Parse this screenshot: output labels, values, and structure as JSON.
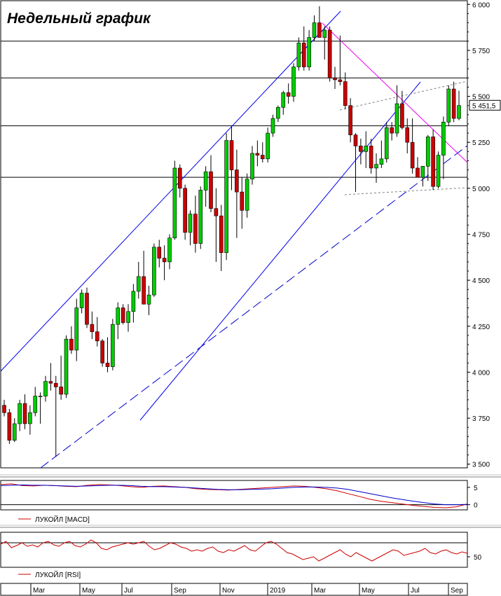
{
  "title": "Недельный график",
  "chart_data": [
    {
      "type": "candlestick",
      "name": "price",
      "title": "Недельный график",
      "ylim": [
        3480,
        6020
      ],
      "yticks": [
        3500,
        3750,
        4000,
        4250,
        4500,
        4750,
        5000,
        5250,
        5500,
        5750,
        6000
      ],
      "ytick_labels": [
        "3 500",
        "3 750",
        "4 000",
        "4 250",
        "4 500",
        "4 750",
        "5 000",
        "5 250",
        "5 500",
        "5 750",
        "6 000"
      ],
      "last_price_label": "5 451,5",
      "last_price": 5451.5,
      "horizontal_levels": [
        5800,
        5600,
        5340,
        5060
      ],
      "x_labels": [
        "Mar",
        "May",
        "Jul",
        "Sep",
        "Nov",
        "2019",
        "Mar",
        "May",
        "Jul",
        "Sep"
      ],
      "colors": {
        "up": "#00cc00",
        "down": "#cc0000",
        "channel": "#0000ee",
        "downtrend": "#ee00ee",
        "level": "#000000",
        "dotted": "#808080"
      },
      "candles_ohlc": [
        [
          3820,
          3850,
          3760,
          3780
        ],
        [
          3780,
          3800,
          3610,
          3630
        ],
        [
          3630,
          3750,
          3620,
          3720
        ],
        [
          3720,
          3850,
          3680,
          3830
        ],
        [
          3830,
          3880,
          3690,
          3720
        ],
        [
          3720,
          3820,
          3660,
          3780
        ],
        [
          3780,
          3920,
          3760,
          3870
        ],
        [
          3870,
          3890,
          3720,
          3870
        ],
        [
          3870,
          3980,
          3840,
          3950
        ],
        [
          3950,
          4050,
          3900,
          3940
        ],
        [
          3940,
          3980,
          3540,
          3920
        ],
        [
          3920,
          4090,
          3850,
          3880
        ],
        [
          3880,
          4200,
          3860,
          4180
        ],
        [
          4180,
          4250,
          4100,
          4120
        ],
        [
          4120,
          4400,
          4060,
          4350
        ],
        [
          4350,
          4450,
          4320,
          4430
        ],
        [
          4430,
          4460,
          4240,
          4260
        ],
        [
          4260,
          4330,
          4180,
          4220
        ],
        [
          4220,
          4300,
          4140,
          4170
        ],
        [
          4170,
          4180,
          4030,
          4050
        ],
        [
          4050,
          4190,
          4000,
          4030
        ],
        [
          4030,
          4290,
          4010,
          4260
        ],
        [
          4260,
          4380,
          4180,
          4350
        ],
        [
          4350,
          4370,
          4260,
          4270
        ],
        [
          4270,
          4370,
          4220,
          4330
        ],
        [
          4330,
          4480,
          4270,
          4440
        ],
        [
          4440,
          4600,
          4400,
          4520
        ],
        [
          4520,
          4660,
          4450,
          4370
        ],
        [
          4370,
          4470,
          4310,
          4420
        ],
        [
          4420,
          4700,
          4410,
          4680
        ],
        [
          4680,
          4720,
          4570,
          4620
        ],
        [
          4620,
          4690,
          4500,
          4600
        ],
        [
          4600,
          4750,
          4560,
          4730
        ],
        [
          4730,
          5150,
          4720,
          5110
        ],
        [
          5110,
          5130,
          4950,
          5000
        ],
        [
          5000,
          5020,
          4720,
          4760
        ],
        [
          4760,
          4880,
          4690,
          4860
        ],
        [
          4860,
          4960,
          4650,
          4700
        ],
        [
          4700,
          5010,
          4670,
          4990
        ],
        [
          4990,
          5120,
          4900,
          5090
        ],
        [
          5090,
          5180,
          4870,
          4890
        ],
        [
          4890,
          5000,
          4600,
          4850
        ],
        [
          4850,
          4910,
          4550,
          4650
        ],
        [
          4650,
          5300,
          4610,
          5260
        ],
        [
          5260,
          5340,
          4990,
          5100
        ],
        [
          5100,
          5210,
          4730,
          4980
        ],
        [
          4980,
          5060,
          4780,
          4880
        ],
        [
          4880,
          5080,
          4840,
          5050
        ],
        [
          5050,
          5230,
          5020,
          5190
        ],
        [
          5190,
          5260,
          5120,
          5180
        ],
        [
          5180,
          5250,
          5140,
          5160
        ],
        [
          5160,
          5330,
          5140,
          5300
        ],
        [
          5300,
          5400,
          5280,
          5380
        ],
        [
          5380,
          5450,
          5360,
          5440
        ],
        [
          5440,
          5530,
          5400,
          5520
        ],
        [
          5520,
          5570,
          5460,
          5500
        ],
        [
          5500,
          5680,
          5470,
          5660
        ],
        [
          5660,
          5820,
          5640,
          5790
        ],
        [
          5790,
          5880,
          5640,
          5660
        ],
        [
          5660,
          5860,
          5640,
          5820
        ],
        [
          5820,
          5940,
          5800,
          5900
        ],
        [
          5900,
          5990,
          5880,
          5820
        ],
        [
          5820,
          5880,
          5700,
          5860
        ],
        [
          5860,
          5880,
          5580,
          5600
        ],
        [
          5600,
          5660,
          5540,
          5590
        ],
        [
          5590,
          5830,
          5560,
          5580
        ],
        [
          5580,
          5630,
          5430,
          5450
        ],
        [
          5450,
          5490,
          5250,
          5290
        ],
        [
          5290,
          5300,
          4980,
          5230
        ],
        [
          5230,
          5270,
          5130,
          5200
        ],
        [
          5200,
          5310,
          5110,
          5230
        ],
        [
          5230,
          5270,
          5080,
          5110
        ],
        [
          5110,
          5190,
          5030,
          5130
        ],
        [
          5130,
          5260,
          5110,
          5160
        ],
        [
          5160,
          5360,
          5140,
          5330
        ],
        [
          5330,
          5360,
          5260,
          5300
        ],
        [
          5300,
          5560,
          5280,
          5460
        ],
        [
          5460,
          5530,
          5320,
          5330
        ],
        [
          5330,
          5380,
          5190,
          5250
        ],
        [
          5250,
          5380,
          5080,
          5110
        ],
        [
          5110,
          5170,
          5060,
          5060
        ],
        [
          5060,
          5110,
          5010,
          5120
        ],
        [
          5120,
          5290,
          5040,
          5280
        ],
        [
          5280,
          5320,
          4990,
          5010
        ],
        [
          5010,
          5200,
          5000,
          5180
        ],
        [
          5180,
          5390,
          5050,
          5360
        ],
        [
          5360,
          5560,
          5340,
          5540
        ],
        [
          5540,
          5580,
          5360,
          5380
        ],
        [
          5380,
          5530,
          5370,
          5450
        ]
      ]
    },
    {
      "type": "line",
      "name": "macd-panel",
      "ylim": [
        -1.5,
        7
      ],
      "yticks": [
        0,
        5
      ],
      "ytick_labels": [
        "0",
        "5"
      ],
      "legend": "ЛУКОЙЛ [MACD]",
      "series": [
        {
          "color": "#cc0000",
          "values": [
            5.8,
            6.0,
            5.5,
            5.4,
            5.6,
            5.5,
            5.3,
            5.2,
            5.6,
            5.8,
            5.7,
            5.5,
            5.2,
            5.0,
            5.3,
            5.4,
            5.2,
            5.0,
            4.6,
            4.4,
            4.3,
            4.2,
            4.4,
            4.6,
            4.8,
            5.0,
            5.2,
            5.4,
            5.3,
            5.0,
            4.6,
            4.0,
            3.2,
            2.4,
            1.6,
            1.0,
            0.6,
            0.2,
            -0.2,
            -0.5,
            -0.8,
            -0.9,
            -0.6,
            0.2
          ]
        },
        {
          "color": "#0000cc",
          "values": [
            5.5,
            5.6,
            5.7,
            5.6,
            5.6,
            5.5,
            5.4,
            5.3,
            5.4,
            5.5,
            5.6,
            5.6,
            5.5,
            5.3,
            5.2,
            5.2,
            5.1,
            5.0,
            4.8,
            4.6,
            4.4,
            4.3,
            4.3,
            4.4,
            4.5,
            4.6,
            4.8,
            5.0,
            5.1,
            5.1,
            5.0,
            4.8,
            4.4,
            3.8,
            3.2,
            2.6,
            2.0,
            1.5,
            1.0,
            0.6,
            0.2,
            0.0,
            0.0,
            0.1
          ]
        }
      ]
    },
    {
      "type": "line",
      "name": "rsi-panel",
      "ylim": [
        35,
        85
      ],
      "yticks": [
        50
      ],
      "ytick_labels": [
        "50"
      ],
      "hlines": [
        70,
        30
      ],
      "legend": "ЛУКОЙЛ [RSI]",
      "series": [
        {
          "color": "#cc0000",
          "values": [
            68,
            72,
            63,
            66,
            70,
            65,
            67,
            64,
            70,
            72,
            67,
            65,
            70,
            72,
            66,
            64,
            68,
            74,
            70,
            62,
            60,
            64,
            66,
            68,
            70,
            68,
            70,
            72,
            65,
            60,
            62,
            66,
            70,
            68,
            64,
            62,
            58,
            60,
            58,
            62,
            64,
            58,
            56,
            60,
            58,
            62,
            66,
            60,
            58,
            64,
            70,
            72,
            68,
            62,
            56,
            54,
            50,
            46,
            48,
            50,
            44,
            48,
            52,
            56,
            60,
            54,
            50,
            56,
            52,
            48,
            44,
            48,
            52,
            56,
            60,
            58,
            52,
            54,
            56,
            58,
            62,
            56,
            54,
            58,
            60,
            56,
            54,
            57,
            55
          ]
        }
      ]
    }
  ]
}
